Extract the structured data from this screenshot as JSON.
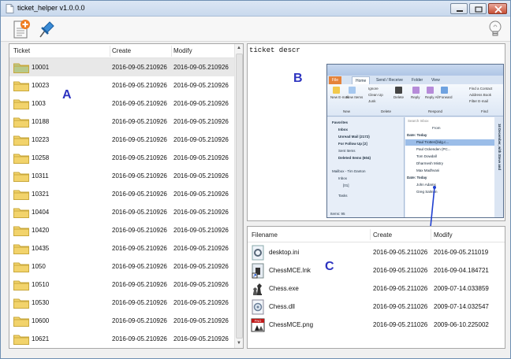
{
  "window": {
    "title": "ticket_helper v1.0.0.0"
  },
  "toolbar": {
    "new_ticket_icon": "add-document-icon",
    "pin_icon": "pushpin-icon",
    "bulb_icon": "lightbulb-icon"
  },
  "tickets": {
    "columns": [
      "Ticket",
      "Create",
      "Modify"
    ],
    "rows": [
      {
        "ticket": "10001",
        "create": "2016-09-05.210926",
        "modify": "2016-09-05.210926"
      },
      {
        "ticket": "10023",
        "create": "2016-09-05.210926",
        "modify": "2016-09-05.210926"
      },
      {
        "ticket": "1003",
        "create": "2016-09-05.210926",
        "modify": "2016-09-05.210926"
      },
      {
        "ticket": "10188",
        "create": "2016-09-05.210926",
        "modify": "2016-09-05.210926"
      },
      {
        "ticket": "10223",
        "create": "2016-09-05.210926",
        "modify": "2016-09-05.210926"
      },
      {
        "ticket": "10258",
        "create": "2016-09-05.210926",
        "modify": "2016-09-05.210926"
      },
      {
        "ticket": "10311",
        "create": "2016-09-05.210926",
        "modify": "2016-09-05.210926"
      },
      {
        "ticket": "10321",
        "create": "2016-09-05.210926",
        "modify": "2016-09-05.210926"
      },
      {
        "ticket": "10404",
        "create": "2016-09-05.210926",
        "modify": "2016-09-05.210926"
      },
      {
        "ticket": "10420",
        "create": "2016-09-05.210926",
        "modify": "2016-09-05.210926"
      },
      {
        "ticket": "10435",
        "create": "2016-09-05.210926",
        "modify": "2016-09-05.210926"
      },
      {
        "ticket": "1050",
        "create": "2016-09-05.210926",
        "modify": "2016-09-05.210926"
      },
      {
        "ticket": "10510",
        "create": "2016-09-05.210926",
        "modify": "2016-09-05.210926"
      },
      {
        "ticket": "10530",
        "create": "2016-09-05.210926",
        "modify": "2016-09-05.210926"
      },
      {
        "ticket": "10600",
        "create": "2016-09-05.210926",
        "modify": "2016-09-05.210926"
      },
      {
        "ticket": "10621",
        "create": "2016-09-05.210926",
        "modify": "2016-09-05.210926"
      }
    ]
  },
  "labels": {
    "a": "A",
    "b": "B",
    "c": "C"
  },
  "description": {
    "text": "ticket descr"
  },
  "outlook": {
    "tabs": [
      "File",
      "Home",
      "Send / Receive",
      "Folder",
      "View"
    ],
    "ribbon": [
      "New E-mail",
      "New Items",
      "Ignore",
      "Clean Up",
      "Junk",
      "Delete",
      "Reply",
      "Reply All",
      "Forward",
      "Find a Contact",
      "Address Book",
      "Filter E-mail",
      "New",
      "Delete",
      "Respond",
      "Find"
    ],
    "nav": {
      "favorites": "Favorites",
      "items": [
        "Inbox",
        "Unread Mail (2172)",
        "For Follow Up [2]",
        "Sent Items",
        "Deleted Items (604)"
      ],
      "mailbox": "Mailbox - Tim Danton",
      "sub_items": [
        "Inbox",
        "[01]"
      ],
      "tasks": "Tasks",
      "status": "Items: 95"
    },
    "list": {
      "search": "Search Inbox",
      "from_col": "From",
      "group_today": "Date: Today",
      "senders_1": [
        "Paul Trotter@idg.c...",
        "Paul Ockenden (PC...",
        "Tom Dowdall",
        "Dharmesh Mistry",
        "Max Madhvani"
      ],
      "group_today_2": "Date: Today",
      "senders_2": [
        "John Adams",
        "Greg Salmon"
      ]
    },
    "todo_bar": "18 December, with Steve and"
  },
  "files": {
    "columns": [
      "Filename",
      "Create",
      "Modify"
    ],
    "rows": [
      {
        "icon": "settings-file-icon",
        "name": "desktop.ini",
        "create": "2016-09-05.211026",
        "modify": "2016-09-05.211019"
      },
      {
        "icon": "shortcut-icon",
        "name": "ChessMCE.lnk",
        "create": "2016-09-05.211026",
        "modify": "2016-09-04.184721"
      },
      {
        "icon": "chess-exe-icon",
        "name": "Chess.exe",
        "create": "2016-09-05.211026",
        "modify": "2009-07-14.033859"
      },
      {
        "icon": "dll-icon",
        "name": "Chess.dll",
        "create": "2016-09-05.211026",
        "modify": "2009-07-14.032547"
      },
      {
        "icon": "png-image-icon",
        "name": "ChessMCE.png",
        "create": "2016-09-05.211026",
        "modify": "2009-06-10.225002"
      }
    ]
  },
  "colors": {
    "label": "#2d33c0",
    "folder": "#f2d36b",
    "folder_selected": "#b8c98a",
    "selection": "#e8e8e8"
  }
}
